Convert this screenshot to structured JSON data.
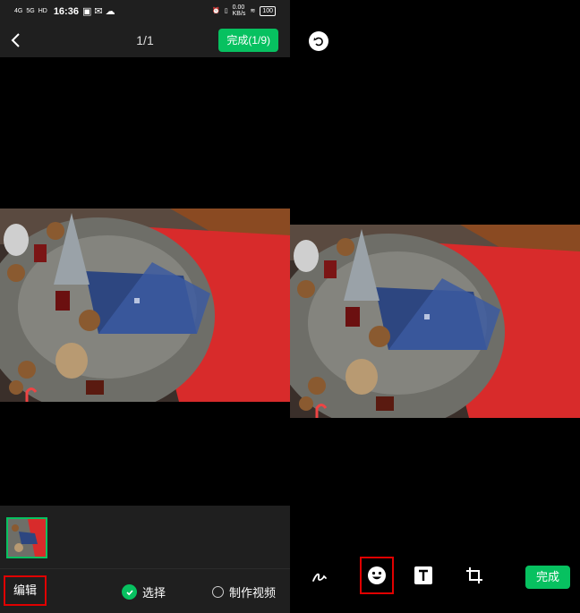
{
  "status_bar": {
    "network_1": "4G",
    "network_2": "5G",
    "hd": "HD",
    "time": "16:36",
    "speed": "0.00\nKB/s",
    "battery": "100"
  },
  "header": {
    "title": "1/1",
    "done_label": "完成(1/9)"
  },
  "bottom_bar": {
    "edit_label": "编辑",
    "select_label": "选择",
    "make_video_label": "制作视频"
  },
  "editor": {
    "done_label": "完成",
    "tools": [
      "draw-icon",
      "emoji-icon",
      "text-icon",
      "crop-icon"
    ]
  },
  "colors": {
    "accent": "#07c160",
    "highlight": "#e00000",
    "bar_bg": "#1f1f1f"
  }
}
